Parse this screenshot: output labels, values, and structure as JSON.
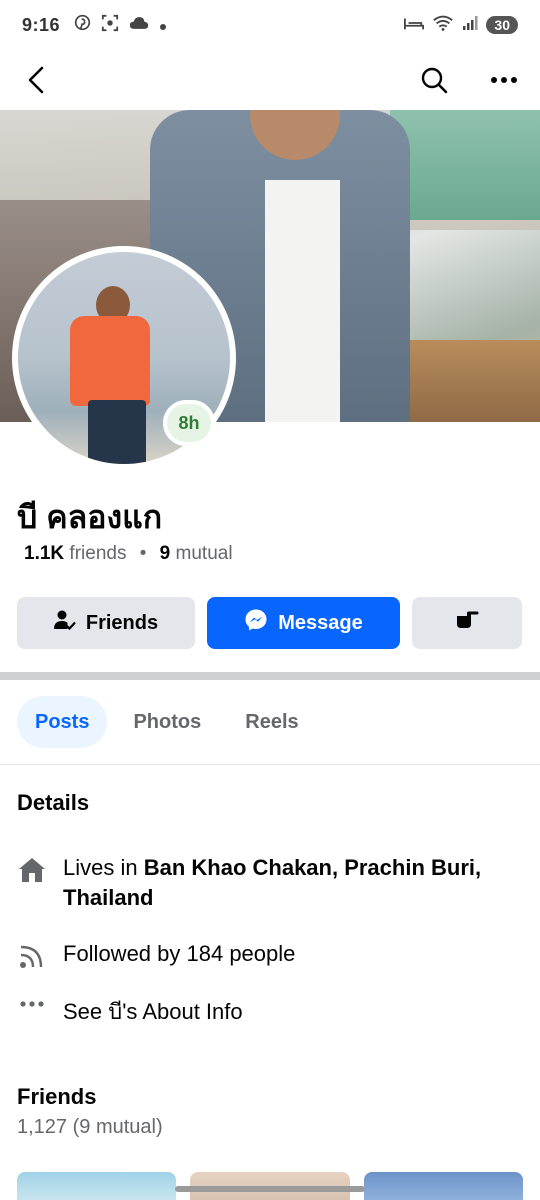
{
  "status_bar": {
    "time": "9:16",
    "battery": "30"
  },
  "nav": {
    "back_icon": "back-arrow-icon",
    "search_icon": "search-icon",
    "more_icon": "more-horizontal-icon"
  },
  "profile": {
    "story_badge": "8h",
    "name": "บี คลองแก",
    "friends_count": "1.1K",
    "friends_label": "friends",
    "separator": "•",
    "mutual_count": "9",
    "mutual_label": "mutual"
  },
  "actions": {
    "friends_label": "Friends",
    "message_label": "Message"
  },
  "tabs": [
    {
      "label": "Posts",
      "active": true
    },
    {
      "label": "Photos",
      "active": false
    },
    {
      "label": "Reels",
      "active": false
    }
  ],
  "details": {
    "title": "Details",
    "lives_prefix": "Lives in ",
    "lives_place_line1": "Ban Khao Chakan, Prachin Buri,",
    "lives_place_line2": "Thailand",
    "followed_by": "Followed by 184 people",
    "see_about": "See บี's About Info"
  },
  "friends_section": {
    "title": "Friends",
    "count": "1,127 (9 mutual)"
  },
  "colors": {
    "accent": "#0866ff",
    "button_gray": "#e4e6eb",
    "tab_active_bg": "#ebf5ff"
  }
}
